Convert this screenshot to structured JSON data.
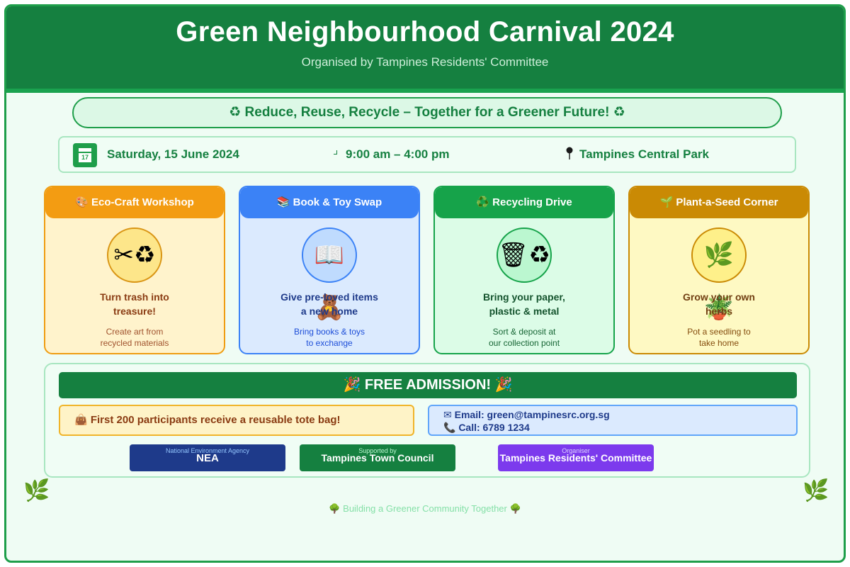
{
  "header": {
    "title": "Green Neighbourhood Carnival 2024",
    "subtitle": "Organised by Tampines Residents' Committee"
  },
  "slogan": "♻ Reduce, Reuse, Recycle – Together for a Greener Future! ♻",
  "info": {
    "calendar_day": "17",
    "date": "Saturday, 15 June 2024",
    "time": "9:00 am – 4:00 pm",
    "venue": "Tampines Central Park"
  },
  "cards": [
    {
      "title": "🎨 Eco-Craft Workshop",
      "icon": "✂♻",
      "icon_name": "scissors-recycle-icon",
      "main_line1": "Turn trash into",
      "main_line2": "treasure!",
      "sub_line1": "Create art from",
      "sub_line2": "recycled materials"
    },
    {
      "title": "📚 Book & Toy Swap",
      "icon": "📖🧸",
      "icon_name": "book-teddy-icon",
      "main_line1": "Give pre-loved items",
      "main_line2": "a new home",
      "sub_line1": "Bring books & toys",
      "sub_line2": "to exchange"
    },
    {
      "title": "♻️ Recycling Drive",
      "icon": "🗑♻",
      "icon_name": "bin-recycle-icon",
      "main_line1": "Bring your paper,",
      "main_line2": "plastic & metal",
      "sub_line1": "Sort & deposit at",
      "sub_line2": "our collection point"
    },
    {
      "title": "🌱 Plant-a-Seed Corner",
      "icon": "🌿🪴",
      "icon_name": "herb-pot-icon",
      "main_line1": "Grow your own",
      "main_line2": "herbs",
      "sub_line1": "Pot a seedling to",
      "sub_line2": "take home"
    }
  ],
  "admission": {
    "banner": "🎉 FREE ADMISSION! 🎉",
    "tote": "👜 First 200 participants receive a reusable tote bag!",
    "email": "✉ Email: green@tampinesrc.org.sg",
    "phone": "📞 Call: 6789 1234"
  },
  "partners": [
    {
      "caption": "National Environment Agency",
      "name": "NEA"
    },
    {
      "caption": "Supported by",
      "name": "Tampines Town Council"
    },
    {
      "caption": "Organiser",
      "name": "Tampines Residents' Committee"
    }
  ],
  "decor": {
    "leaf": "🌿"
  },
  "footer": "🌳 Building a Greener Community Together 🌳",
  "colors": {
    "primary_green": "#158040",
    "accent_green": "#1e9e4a",
    "background": "#effcf4",
    "eco_craft": "#f39c12",
    "book_swap": "#3b82f6",
    "recycling": "#16a34a",
    "plant_seed": "#ca8a04",
    "nea": "#1e3a8a",
    "organiser": "#7c3aed"
  }
}
